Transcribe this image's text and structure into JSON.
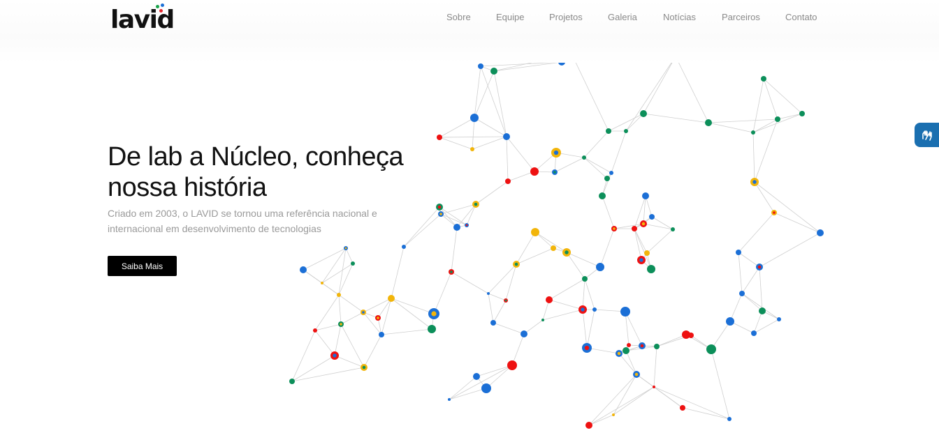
{
  "brand": {
    "logo_text": "lavid",
    "dot_colors": [
      "#e3262d",
      "#19a34a",
      "#1b6fd6"
    ]
  },
  "nav": {
    "items": [
      {
        "label": "Sobre"
      },
      {
        "label": "Equipe"
      },
      {
        "label": "Projetos"
      },
      {
        "label": "Galeria"
      },
      {
        "label": "Notícias"
      },
      {
        "label": "Parceiros"
      },
      {
        "label": "Contato"
      }
    ]
  },
  "hero": {
    "title_line1": "De lab a Núcleo, conheça",
    "title_line2": "nossa história",
    "subtitle_line1": "Criado em 2003, o LAVID se tornou uma referência nacional e",
    "subtitle_line2": "internacional em desenvolvimento de tecnologias",
    "cta_label": "Saiba Mais"
  },
  "accessibility": {
    "icon": "sign-language-hands-icon",
    "color": "#1a6fb0"
  },
  "network": {
    "palette": {
      "blue": "#1b6fd6",
      "green": "#0c8f5a",
      "yellow": "#f2b50a",
      "red": "#ee1111",
      "line": "#cfcfcf"
    }
  }
}
